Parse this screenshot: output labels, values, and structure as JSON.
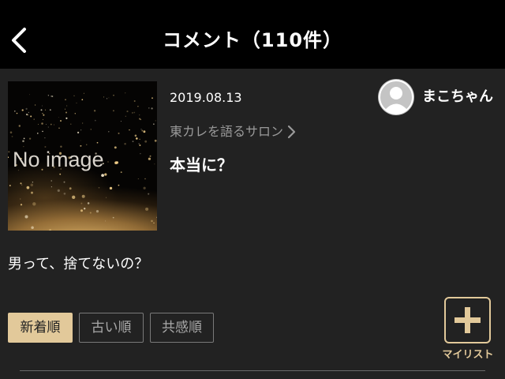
{
  "header": {
    "title": "コメント（110件）",
    "back_icon": "chevron-left-icon"
  },
  "post": {
    "thumbnail_text": "No image",
    "date": "2019.08.13",
    "username": "まこちゃん",
    "avatar_icon": "default-user-icon",
    "category": "東カレを語るサロン",
    "title": "本当に？",
    "body": "男って、捨てないの？"
  },
  "sort": {
    "options": [
      "新着順",
      "古い順",
      "共感順"
    ],
    "selected": "新着順"
  },
  "mylist": {
    "label": "マイリスト",
    "icon": "plus-icon"
  },
  "colors": {
    "background": "#222222",
    "header_background": "#000000",
    "accent_gold": "#e2c99a",
    "muted_text": "#9a9a9a"
  }
}
